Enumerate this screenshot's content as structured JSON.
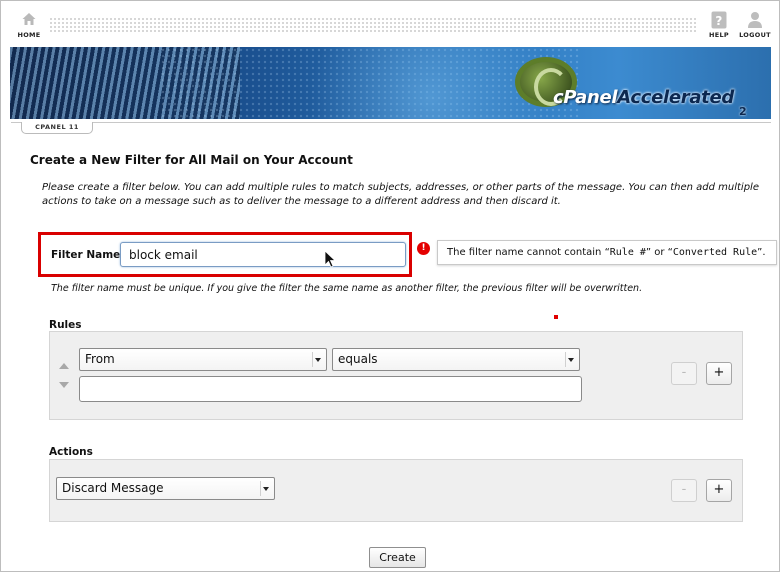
{
  "topnav": {
    "home_label": "HOME",
    "help_label": "HELP",
    "logout_label": "LOGOUT"
  },
  "banner": {
    "logo_text_cpanel": "cPanel",
    "logo_text_accelerated": "Accelerated",
    "logo_superscript": "2"
  },
  "version_tab": "CPANEL 11",
  "page": {
    "title": "Create a New Filter for All Mail on Your Account",
    "intro": "Please create a filter below. You can add multiple rules to match subjects, addresses, or other parts of the message. You can then add multiple actions to take on a message such as to deliver the message to a different address and then discard it."
  },
  "filter_name": {
    "label": "Filter Name:",
    "value": "block email",
    "hint": "The filter name must be unique. If you give the filter the same name as another filter, the previous filter will be overwritten.",
    "error_icon": "!",
    "error_prefix": "The filter name cannot contain “",
    "error_code1": "Rule #",
    "error_mid": "” or “",
    "error_code2": "Converted Rule",
    "error_suffix": "”."
  },
  "rules": {
    "title": "Rules",
    "field_selected": "From",
    "operator_selected": "equals",
    "value": "",
    "minus_label": "-",
    "plus_label": "+"
  },
  "actions": {
    "title": "Actions",
    "action_selected": "Discard Message",
    "minus_label": "-",
    "plus_label": "+"
  },
  "create_button": "Create",
  "icons": {
    "home": "home-icon",
    "help": "help-icon",
    "logout": "logout-icon",
    "error": "error-icon"
  },
  "colors": {
    "highlight_border": "#d90000",
    "error_icon": "#e40000",
    "panel_bg": "#efefef"
  }
}
